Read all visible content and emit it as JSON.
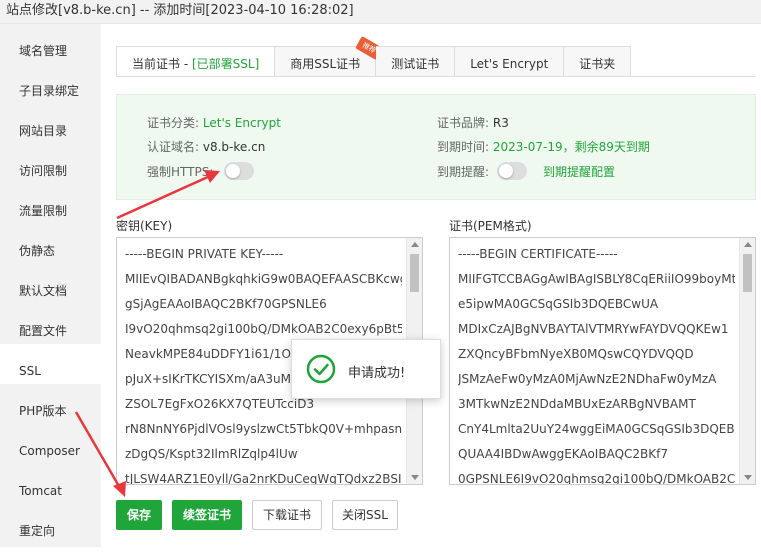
{
  "window": {
    "title": "站点修改[v8.b-ke.cn] -- 添加时间[2023-04-10 16:28:02]"
  },
  "sidebar": {
    "items": [
      {
        "label": "域名管理"
      },
      {
        "label": "子目录绑定"
      },
      {
        "label": "网站目录"
      },
      {
        "label": "访问限制"
      },
      {
        "label": "流量限制"
      },
      {
        "label": "伪静态"
      },
      {
        "label": "默认文档"
      },
      {
        "label": "配置文件"
      },
      {
        "label": "SSL",
        "active": true
      },
      {
        "label": "PHP版本"
      },
      {
        "label": "Composer"
      },
      {
        "label": "Tomcat"
      },
      {
        "label": "重定向"
      }
    ]
  },
  "tabs": {
    "current_prefix": "当前证书 - ",
    "current_status": "[已部署SSL]",
    "commercial": "商用SSL证书",
    "commercial_badge": "推荐",
    "test": "测试证书",
    "letsencrypt": "Let's Encrypt",
    "folder": "证书夹"
  },
  "cert_info": {
    "category_label": "证书分类:",
    "category_value": "Let's Encrypt",
    "domain_label": "认证域名:",
    "domain_value": "v8.b-ke.cn",
    "force_https_label": "强制HTTPS:",
    "force_https_on": false,
    "brand_label": "证书品牌:",
    "brand_value": "R3",
    "expire_label": "到期时间:",
    "expire_value": "2023-07-19，剩余89天到期",
    "remind_label": "到期提醒:",
    "remind_on": false,
    "remind_link": "到期提醒配置"
  },
  "key_area": {
    "label": "密钥(KEY)",
    "lines": [
      "-----BEGIN PRIVATE KEY-----",
      "MIIEvQIBADANBgkqhkiG9w0BAQEFAASCBKcwg",
      "gSjAgEAAoIBAQC2BKf70GPSNLE6",
      "I9vO20qhmsq2gi100bQ/DMkOAB2C0exy6pBt50",
      "NeavkMPE84uDDFY1i61/1OS",
      "pJuX+sIKrTKCYISXm/aA3uM2",
      "ZSOL7EgFxO26KX7QTEUTcciD3",
      "rN8NnNY6PjdlVOsl9yslzwCt5TbkQ0V+mhpasnf",
      "zDgQS/Kspt32IlmRlZqlp4lUw",
      "tJLSW4ARZ1E0yll/Ga2nrKDuCeqWgTQdxz2BSI4"
    ]
  },
  "cert_area": {
    "label": "证书(PEM格式)",
    "lines": [
      "-----BEGIN CERTIFICATE-----",
      "MIIFGTCCBAGgAwIBAgISBLY8CqERiiIO99boyMt",
      "e5ipwMA0GCSqGSIb3DQEBCwUA",
      "MDIxCzAJBgNVBAYTAlVTMRYwFAYDVQQKEw1",
      "ZXQncyBFbmNyeXB0MQswCQYDVQQD",
      "JSMzAeFw0yMzA0MjAwNzE2NDhaFw0yMzA",
      "3MTkwNzE2NDdaMBUxEzARBgNVBAMT",
      "CnY4Lmlta2UuY24wggEiMA0GCSqGSIb3DQEBA",
      "QUAA4IBDwAwggEKAoIBAQC2BKf7",
      "0GPSNLE6I9vO20qhmsq2gi100bQ/DMkOAB2C0"
    ]
  },
  "buttons": {
    "save": "保存",
    "renew": "续签证书",
    "download": "下载证书",
    "close_ssl": "关闭SSL"
  },
  "toast": {
    "message": "申请成功!"
  },
  "colors": {
    "accent": "#20a53a",
    "annotation": "#e8383d",
    "badge": "#e85f3a"
  }
}
